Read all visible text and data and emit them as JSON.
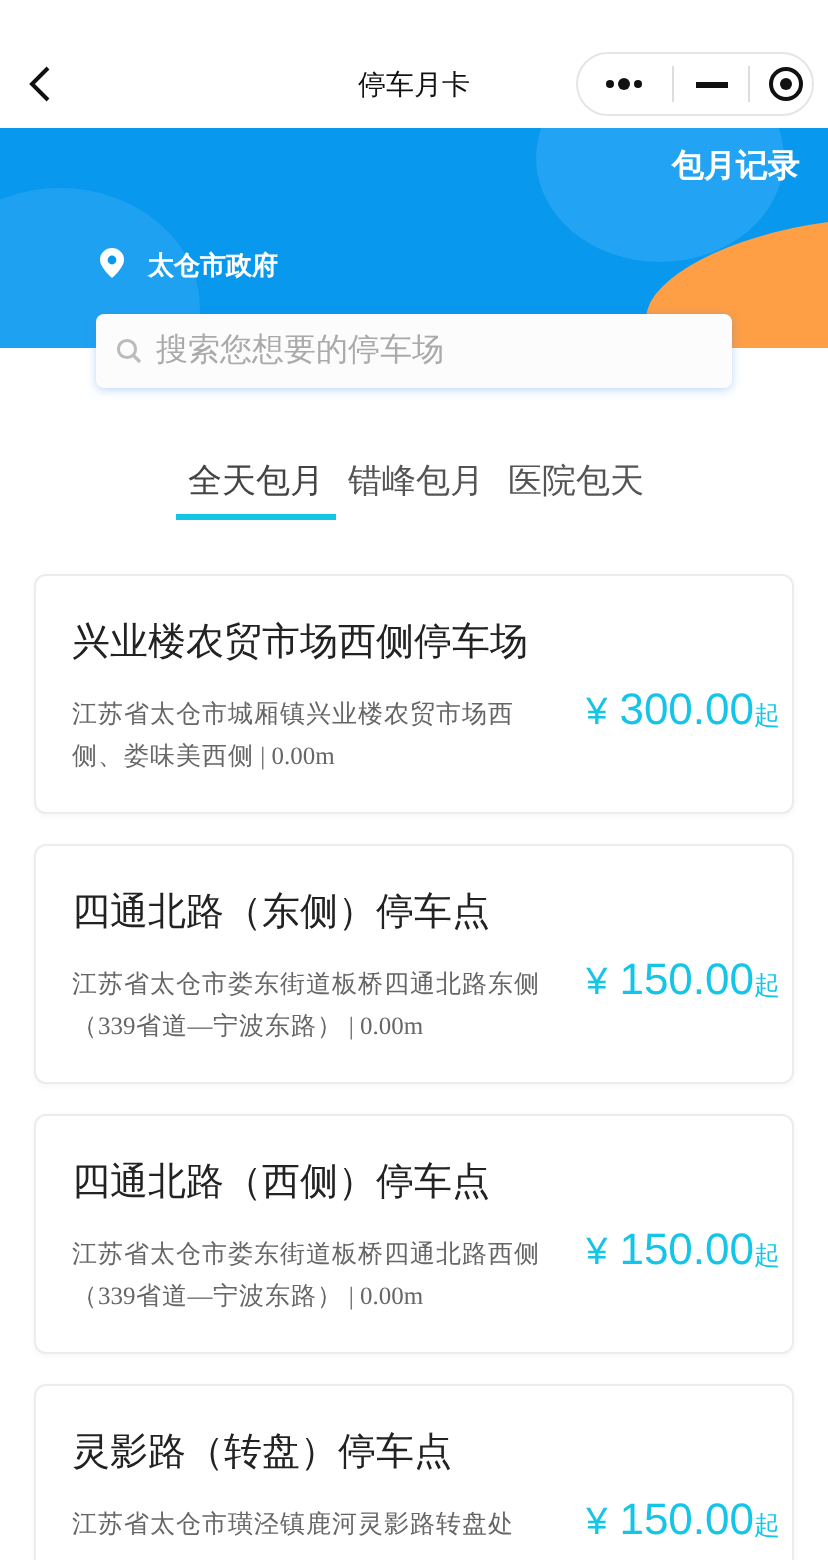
{
  "nav": {
    "title": "停车月卡"
  },
  "banner": {
    "record_link": "包月记录",
    "location": "太仓市政府"
  },
  "search": {
    "placeholder": "搜索您想要的停车场"
  },
  "tabs": [
    {
      "label": "全天包月",
      "selected": true
    },
    {
      "label": "错峰包月",
      "selected": false
    },
    {
      "label": "医院包天",
      "selected": false
    }
  ],
  "lots": [
    {
      "name": "兴业楼农贸市场西侧停车场",
      "detail": "江苏省太仓市城厢镇兴业楼农贸市场西侧、娄味美西侧 | 0.00m",
      "currency": "¥",
      "amount": "300.00",
      "suffix": "起"
    },
    {
      "name": "四通北路（东侧）停车点",
      "detail": "江苏省太仓市娄东街道板桥四通北路东侧（339省道—宁波东路） | 0.00m",
      "currency": "¥",
      "amount": "150.00",
      "suffix": "起"
    },
    {
      "name": "四通北路（西侧）停车点",
      "detail": "江苏省太仓市娄东街道板桥四通北路西侧（339省道—宁波东路） | 0.00m",
      "currency": "¥",
      "amount": "150.00",
      "suffix": "起"
    },
    {
      "name": "灵影路（转盘）停车点",
      "detail": "江苏省太仓市璜泾镇鹿河灵影路转盘处",
      "currency": "¥",
      "amount": "150.00",
      "suffix": "起"
    }
  ]
}
